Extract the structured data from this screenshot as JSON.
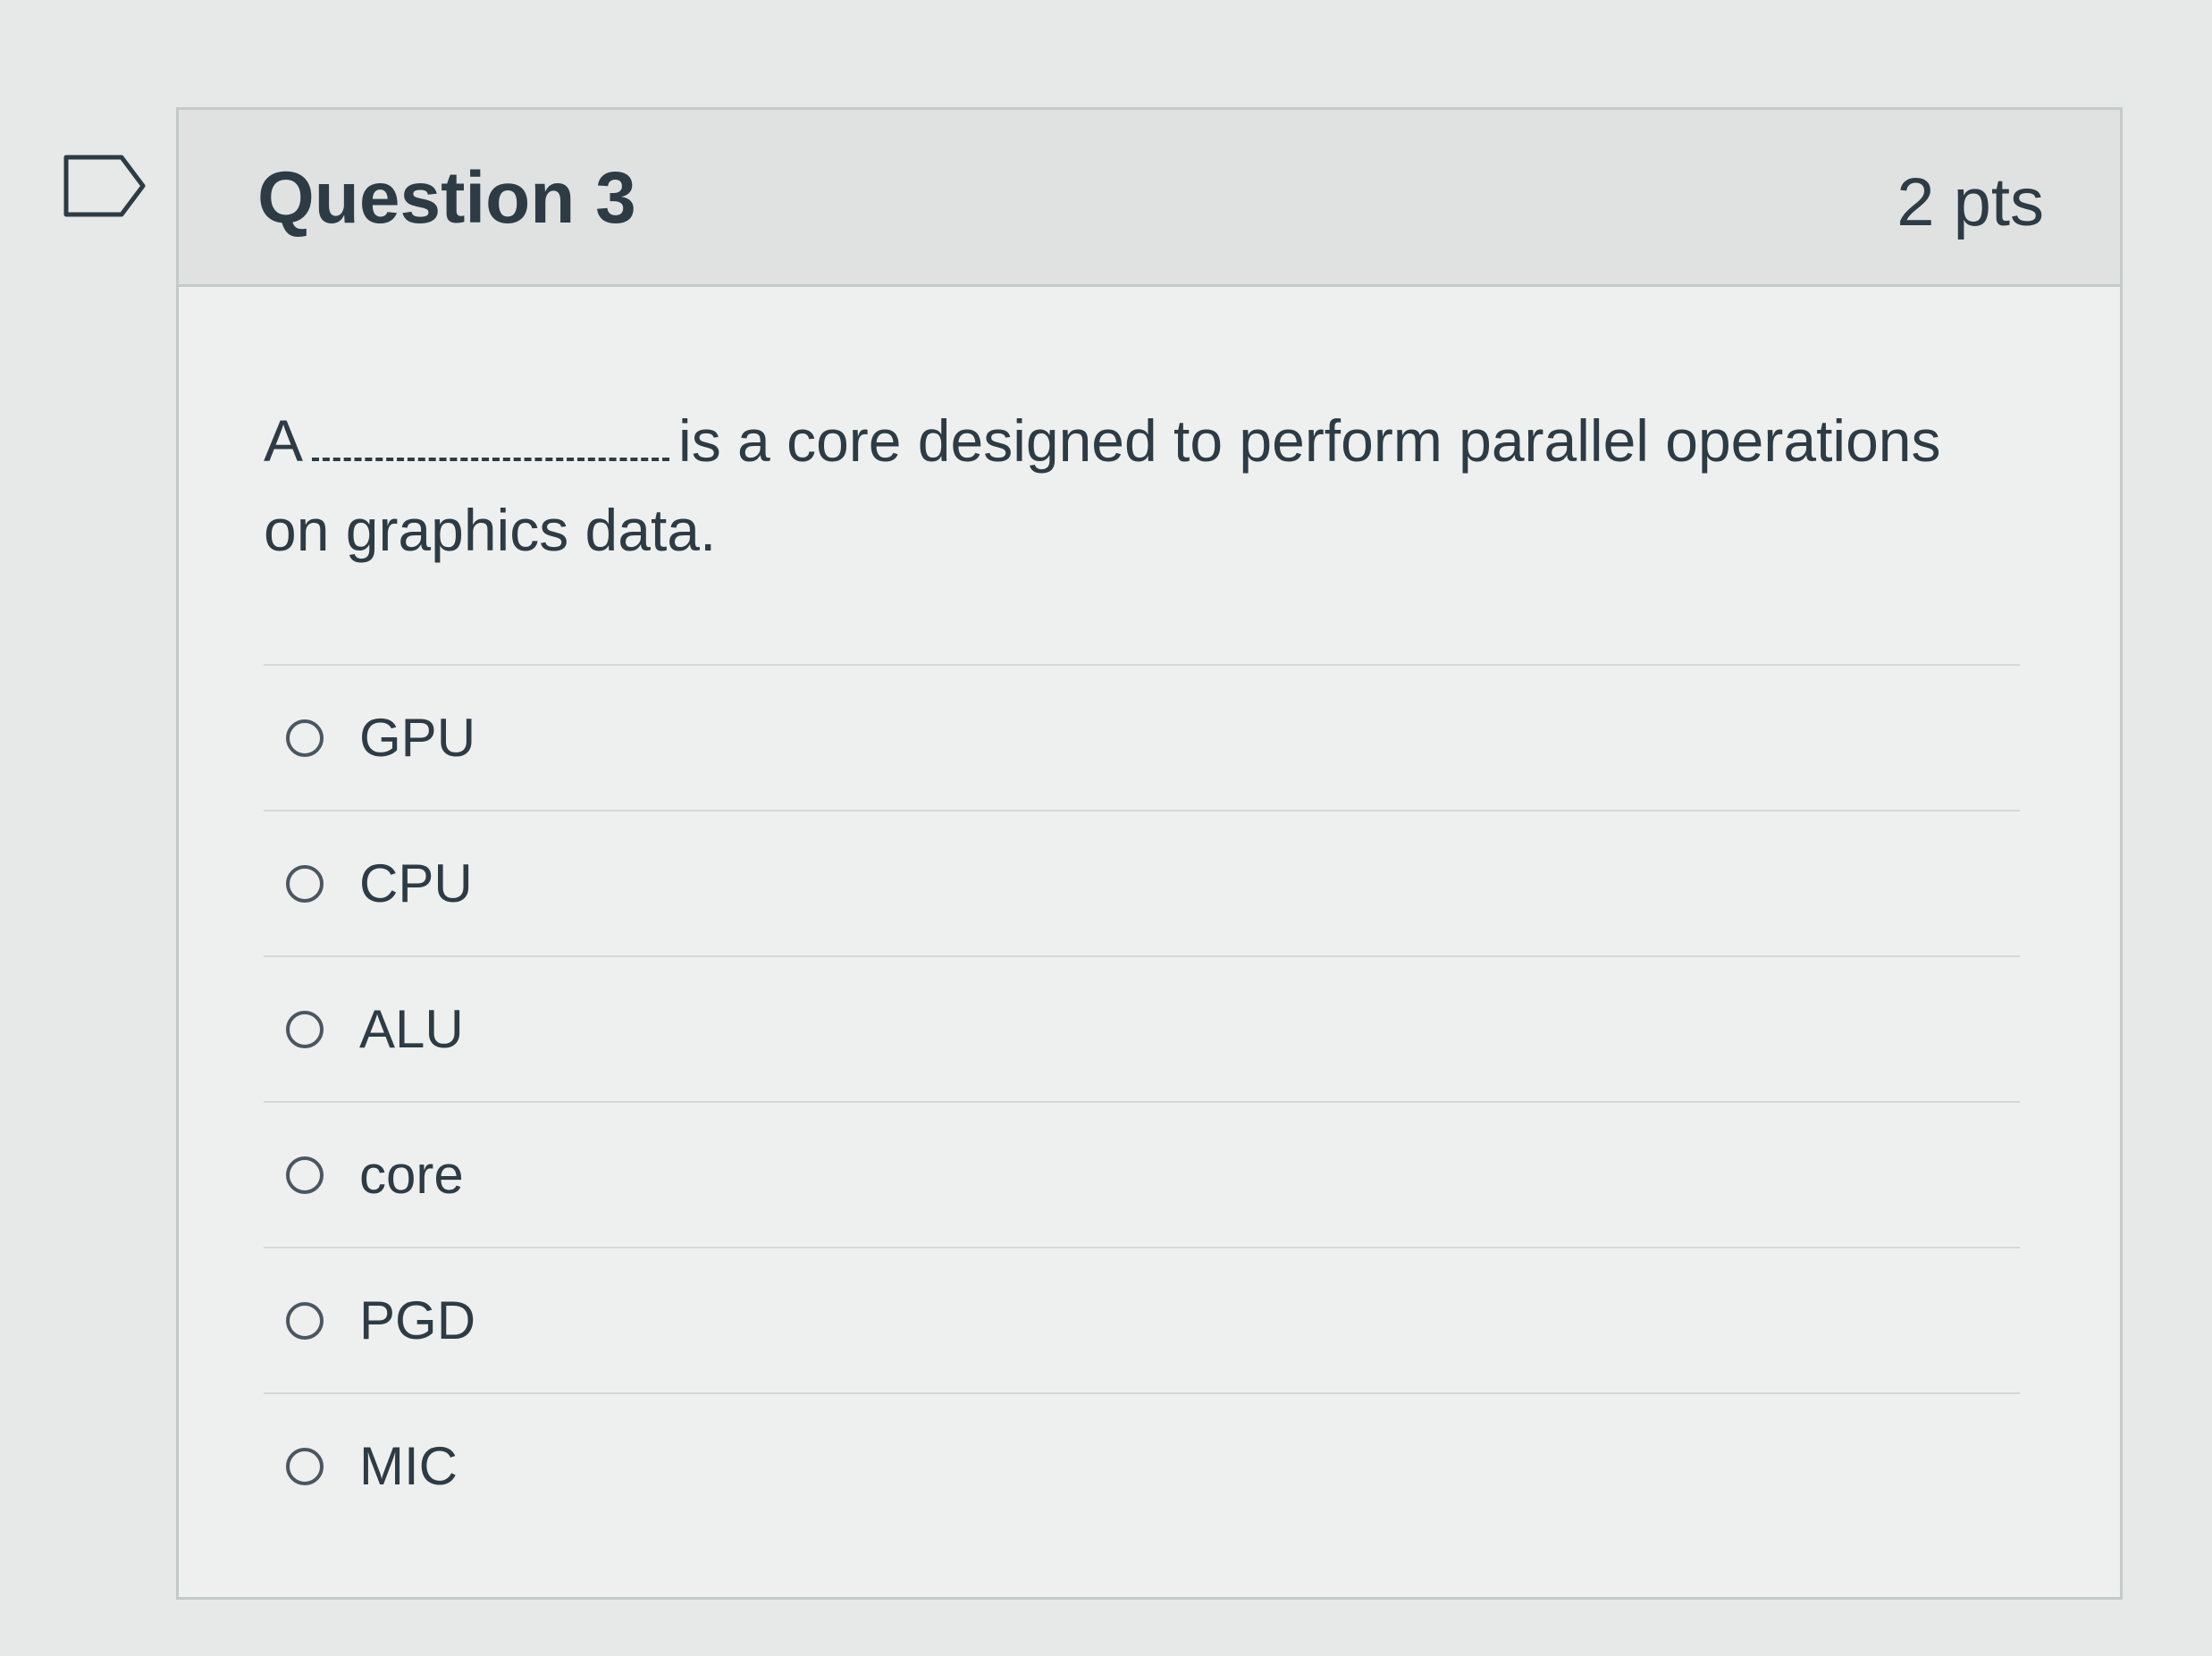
{
  "question": {
    "title": "Question 3",
    "points": "2 pts",
    "text_before": "A",
    "text_after": "is a core designed to perform parallel operations on graphics data."
  },
  "answers": [
    {
      "label": "GPU"
    },
    {
      "label": "CPU"
    },
    {
      "label": "ALU"
    },
    {
      "label": "core"
    },
    {
      "label": "PGD"
    },
    {
      "label": "MIC"
    }
  ],
  "icons": {
    "flag": "flag-icon",
    "radio": "radio-unselected-icon"
  }
}
